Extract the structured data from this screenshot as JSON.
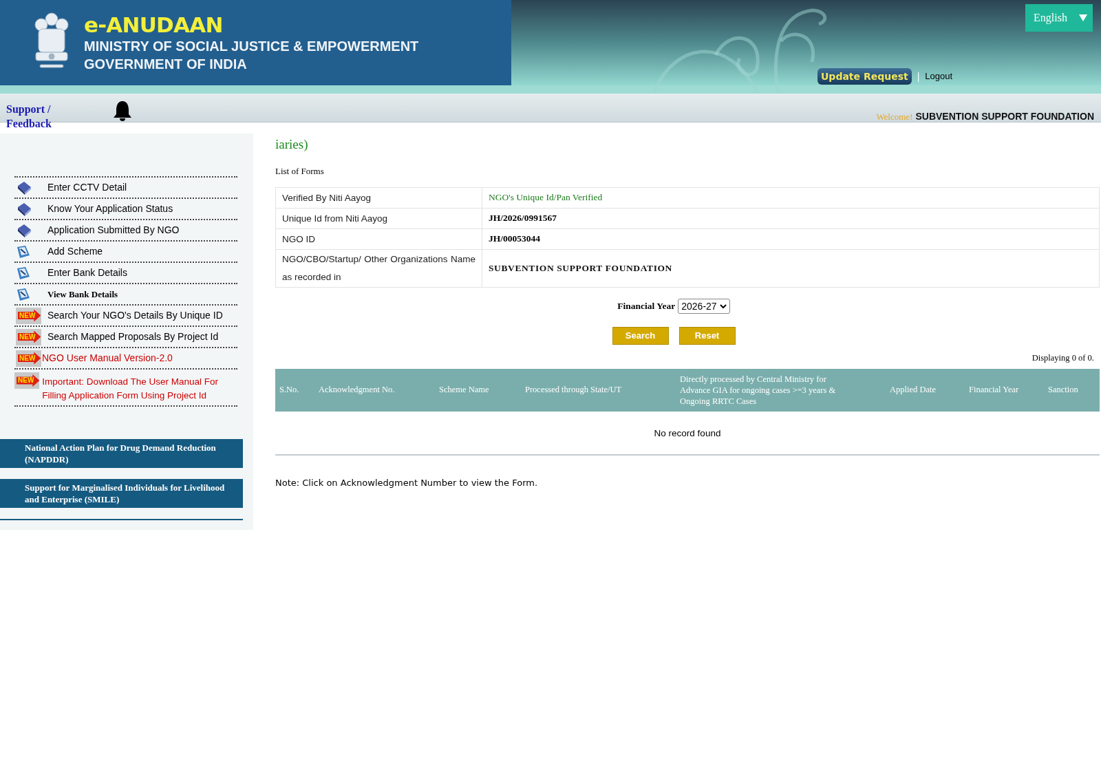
{
  "header": {
    "brand": "e-ANUDAAN",
    "ministry": "MINISTRY OF SOCIAL JUSTICE & EMPOWERMENT",
    "government": "GOVERNMENT OF INDIA",
    "language": "English",
    "update_request": "Update Request",
    "separator": "|",
    "logout": "Logout"
  },
  "topbar": {
    "support": "Support / Feedback",
    "welcome": "Welcome!",
    "user": "SUBVENTION SUPPORT FOUNDATION"
  },
  "sidebar": {
    "items": [
      {
        "kind": "book",
        "label": "Enter CCTV Detail",
        "color": "#000000"
      },
      {
        "kind": "book",
        "label": "Know Your Application Status",
        "color": "#000000"
      },
      {
        "kind": "book",
        "label": "Application Submitted By NGO",
        "color": "#000000"
      },
      {
        "kind": "scroll",
        "label": "Add Scheme",
        "color": "#000000"
      },
      {
        "kind": "scroll",
        "label": "Enter Bank Details",
        "color": "#000000"
      },
      {
        "kind": "scroll",
        "label": "View Bank Details",
        "color": "#000000",
        "serif": true
      },
      {
        "kind": "new",
        "badge": "NEW",
        "label": "Search Your NGO's Details By Unique ID",
        "color": "#000000"
      },
      {
        "kind": "new",
        "badge": "NEW",
        "label": "Search Mapped Proposals By Project Id",
        "color": "#000000"
      },
      {
        "kind": "new",
        "badge": "NEW",
        "label": "NGO User Manual Version-2.0",
        "color": "#cc0000"
      },
      {
        "kind": "new",
        "badge": "NEW",
        "label": "Important: Download The User Manual For Filling Application Form Using Project Id",
        "color": "#cc0000"
      }
    ],
    "banners": [
      "National Action Plan for Drug Demand Reduction (NAPDDR)",
      "Support for Marginalised Individuals for Livelihood and Enterprise (SMILE)"
    ]
  },
  "main": {
    "heading": "iaries)",
    "subheading": "List of Forms",
    "info": [
      {
        "label": "Verified By Niti Aayog",
        "value": "NGO's Unique Id/Pan Verified",
        "kind": "status"
      },
      {
        "label": "Unique Id from Niti Aayog",
        "value": "JH/2026/0991567",
        "kind": "bold"
      },
      {
        "label": "NGO ID",
        "value": "JH/00053044",
        "kind": "bold"
      },
      {
        "label": "NGO/CBO/Startup/ Other Organizations Name as recorded in",
        "value": "SUBVENTION SUPPORT FOUNDATION",
        "kind": "name"
      }
    ],
    "financial_year": {
      "label": "Financial Year",
      "value": "2026-27"
    },
    "buttons": [
      "Search",
      "Reset"
    ],
    "displaying": "Displaying 0 of 0.",
    "table": {
      "columns": [
        "S.No.",
        "Acknowledgment No.",
        "Scheme Name",
        "Processed through State/UT",
        "Directly processed by Central Ministry for Advance GIA for ongoing cases >=3 years & Ongoing RRTC Cases",
        "Applied Date",
        "Financial Year",
        "Sanction"
      ],
      "empty": "No record found"
    },
    "note": "Note: Click on Acknowledgment Number to view the Form."
  }
}
